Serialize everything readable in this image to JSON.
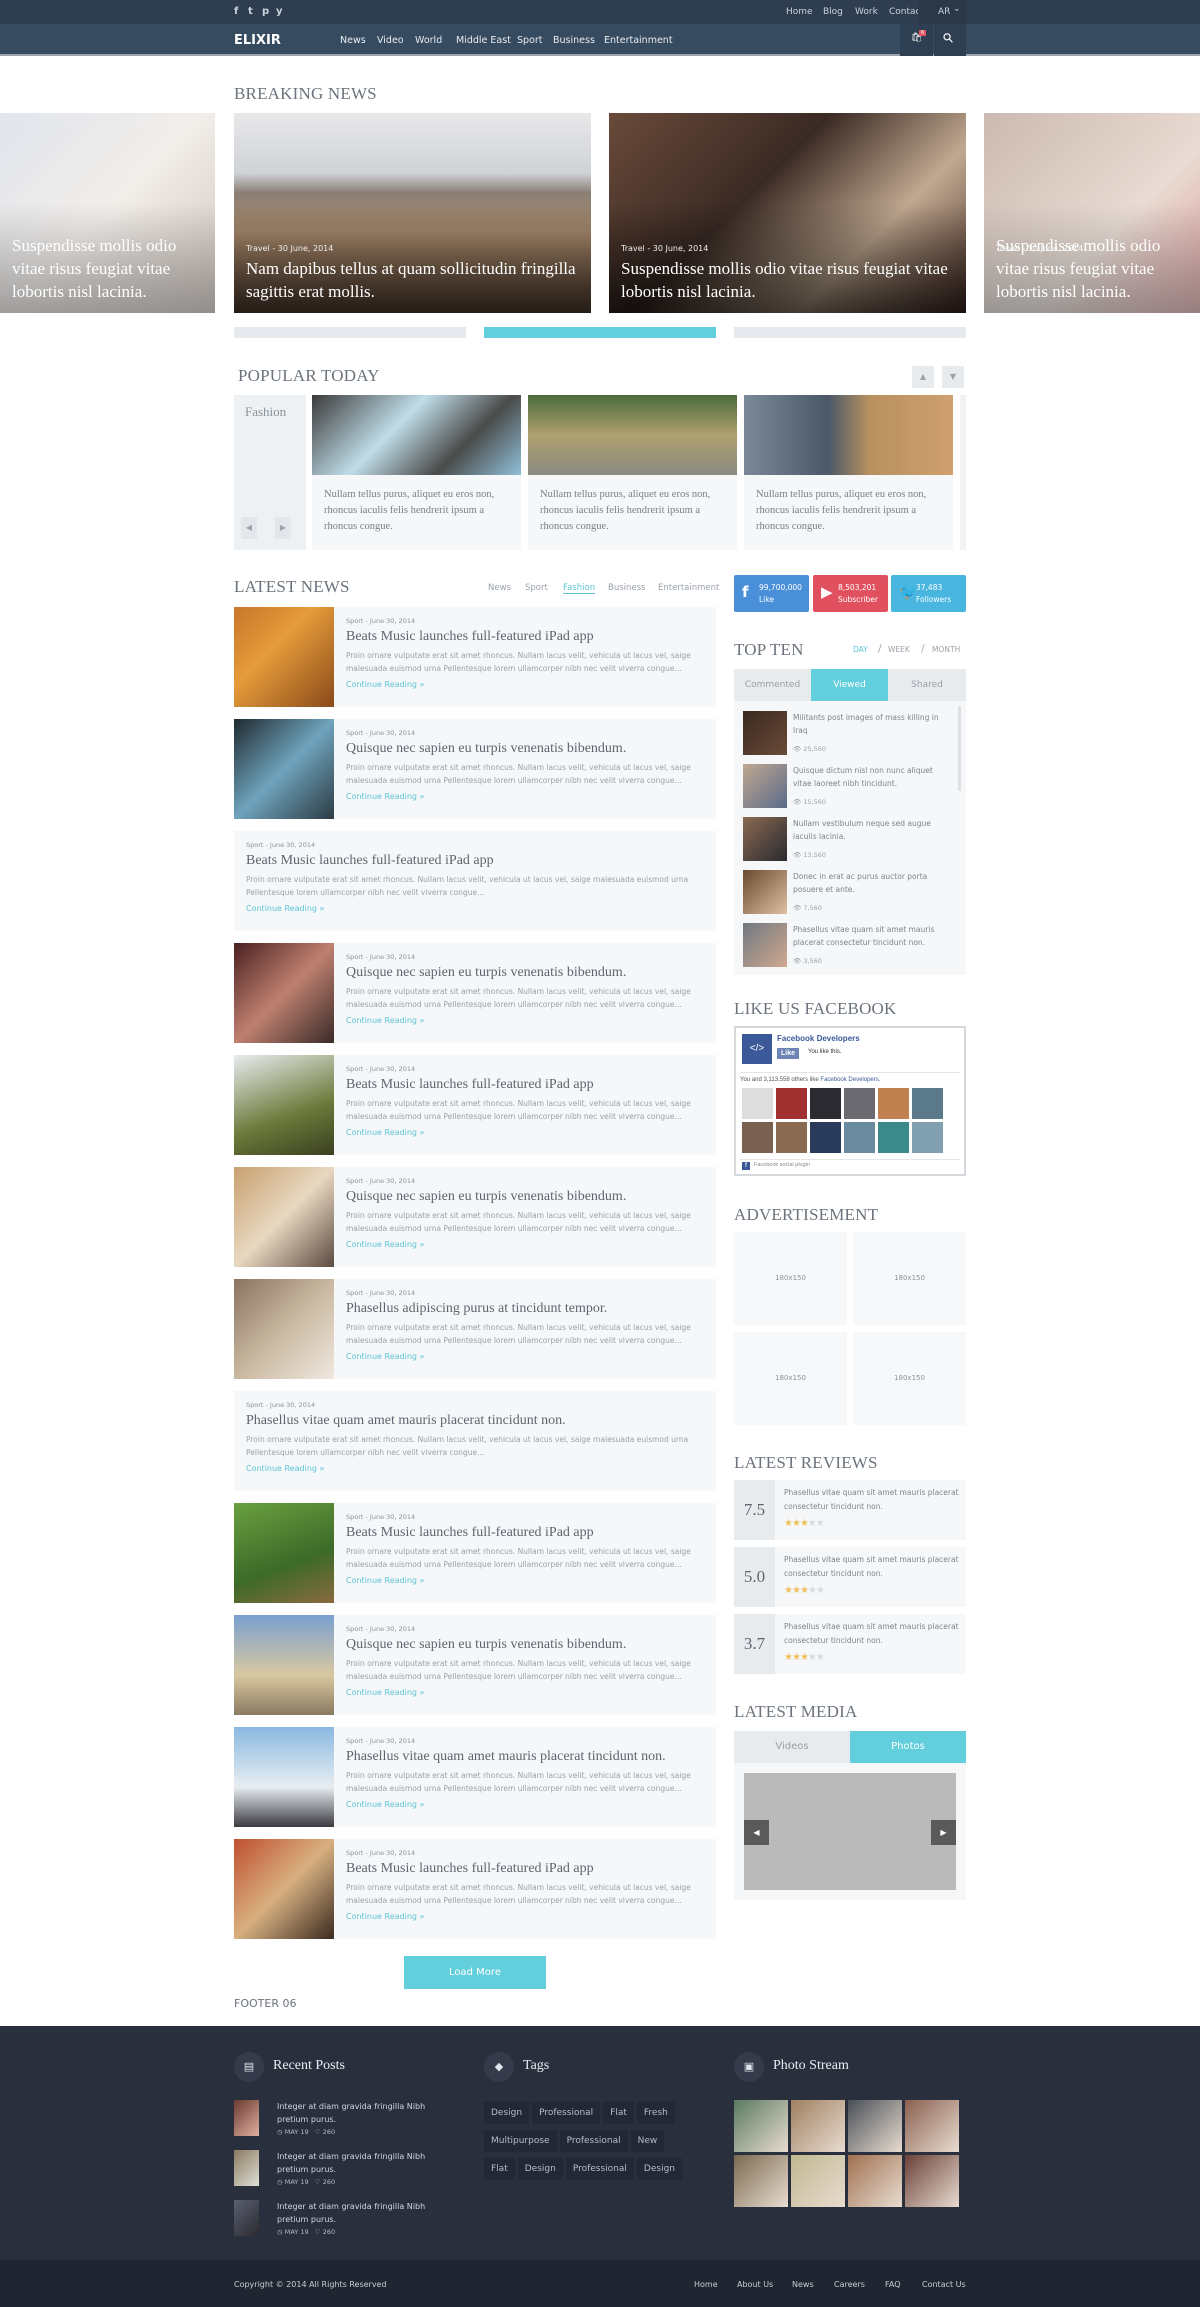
{
  "topbar": {
    "social_icons": [
      "facebook-icon",
      "twitter-icon",
      "pinterest-icon",
      "youtube-icon"
    ],
    "links": [
      "Home",
      "Blog",
      "Work",
      "Contact"
    ],
    "language": "AR"
  },
  "navbar": {
    "logo": "ELIXIR",
    "items": [
      "News",
      "Video",
      "World",
      "Middle East",
      "Sport",
      "Business",
      "Entertainment"
    ],
    "cart_count": "6"
  },
  "breaking": {
    "title": "BREAKING NEWS",
    "slides": [
      {
        "meta": "",
        "title": "Suspendisse mollis odio vitae risus feugiat vitae lobortis nisl lacinia."
      },
      {
        "meta": "Travel - 30 June, 2014",
        "title": "Nam dapibus tellus at quam sollicitudin fringilla sagittis erat mollis."
      },
      {
        "meta": "Travel - 30 June, 2014",
        "title": "Suspendisse mollis odio vitae risus feugiat vitae lobortis nisl lacinia."
      },
      {
        "meta": "Travel - 30 June, 2014",
        "title": "Suspendisse mollis odio vitae risus feugiat vitae lobortis nisl lacinia."
      }
    ],
    "active_page": 2
  },
  "popular": {
    "title": "POPULAR TODAY",
    "category": "Fashion",
    "cards": [
      {
        "text": "Nullam tellus purus, aliquet eu eros non, rhoncus iaculis felis hendrerit ipsum a rhoncus congue."
      },
      {
        "text": "Nullam tellus purus, aliquet eu eros non, rhoncus iaculis felis hendrerit ipsum a rhoncus congue."
      },
      {
        "text": "Nullam tellus purus, aliquet eu eros non, rhoncus iaculis felis hendrerit ipsum a rhoncus congue."
      }
    ]
  },
  "latest": {
    "title": "LATEST NEWS",
    "filters": [
      "News",
      "Sport",
      "Fashion",
      "Business",
      "Entertainment"
    ],
    "active_filter": "Fashion",
    "excerpt": "Proin ornare vulputate erat sit amet rhoncus. Nullam lacus velit, vehicula ut lacus vel, saige malesuada euismod urna Pellentesque  lorem ullamcorper nibh nec velit viverra congue...",
    "meta": "Sport - June 30, 2014",
    "more": "Continue Reading",
    "articles": [
      {
        "title": "Beats Music launches full-featured iPad app",
        "image": true
      },
      {
        "title": "Quisque nec sapien eu turpis venenatis bibendum.",
        "image": true
      },
      {
        "title": "Beats Music launches full-featured iPad app",
        "image": false
      },
      {
        "title": "Quisque nec sapien eu turpis venenatis bibendum.",
        "image": true
      },
      {
        "title": "Beats Music launches full-featured iPad app",
        "image": true
      },
      {
        "title": "Quisque nec sapien eu turpis venenatis bibendum.",
        "image": true
      },
      {
        "title": "Phasellus adipiscing purus at tincidunt tempor.",
        "image": true
      },
      {
        "title": "Phasellus vitae quam amet mauris placerat tincidunt non.",
        "image": false
      },
      {
        "title": "Beats Music launches full-featured iPad app",
        "image": true
      },
      {
        "title": "Quisque nec sapien eu turpis venenatis bibendum.",
        "image": true
      },
      {
        "title": "Phasellus vitae quam amet mauris placerat tincidunt non.",
        "image": true
      },
      {
        "title": "Beats Music launches full-featured iPad app",
        "image": true
      }
    ],
    "load_more": "Load More"
  },
  "footer_label": "FOOTER 06",
  "social": [
    {
      "icon": "facebook-icon",
      "count": "99,700,000",
      "label": "Like",
      "color": "#4a90d9"
    },
    {
      "icon": "youtube-icon",
      "count": "8,503,201",
      "label": "Subscriber",
      "color": "#e0505f"
    },
    {
      "icon": "twitter-icon",
      "count": "37,483",
      "label": "Followers",
      "color": "#49b6e0"
    }
  ],
  "topten": {
    "title": "TOP TEN",
    "periods": [
      "DAY",
      "WEEK",
      "MONTH"
    ],
    "active_period": "DAY",
    "tabs": [
      "Commented",
      "Viewed",
      "Shared"
    ],
    "active_tab": "Viewed",
    "items": [
      {
        "title": "Militants post images of mass killing in Iraq",
        "views": "25,560"
      },
      {
        "title": "Quisque dictum nisl non nunc aliquet vitae laoreet nibh tincidunt.",
        "views": "15,560"
      },
      {
        "title": "Nullam vestibulum neque sed augue iaculis lacinia.",
        "views": "13,560"
      },
      {
        "title": "Donec in erat ac purus auctor porta posuere et ante.",
        "views": "7,560"
      },
      {
        "title": "Phasellus vitae quam sit amet mauris placerat consectetur tincidunt non.",
        "views": "3,560"
      }
    ]
  },
  "facebook": {
    "title": "LIKE US FACEBOOK",
    "page_name": "Facebook Developers",
    "like_label": "Like",
    "you_like": "You like this.",
    "others_prefix": "You and 3,113,558 others like ",
    "others_link": "Facebook Developers.",
    "plugin_label": "Facebook social plugin"
  },
  "ads": {
    "title": "ADVERTISEMENT",
    "slots": [
      "180x150",
      "180x150",
      "180x150",
      "180x150"
    ]
  },
  "reviews": {
    "title": "LATEST REVIEWS",
    "items": [
      {
        "score": "7.5",
        "text": "Phasellus vitae quam sit amet mauris placerat consectetur tincidunt non.",
        "stars": 3
      },
      {
        "score": "5.0",
        "text": "Phasellus vitae quam sit amet mauris placerat consectetur tincidunt non.",
        "stars": 3
      },
      {
        "score": "3.7",
        "text": "Phasellus vitae quam sit amet mauris placerat consectetur tincidunt non.",
        "stars": 3
      }
    ],
    "max_stars": 5
  },
  "media": {
    "title": "LATEST MEDIA",
    "tabs": [
      "Videos",
      "Photos"
    ],
    "active_tab": "Photos"
  },
  "footer": {
    "recent_title": "Recent Posts",
    "posts": [
      {
        "title": "Integer at diam gravida fringilla Nibh pretium purus.",
        "date": "MAY 19",
        "likes": "260"
      },
      {
        "title": "Integer at diam gravida fringilla Nibh pretium purus.",
        "date": "MAY 19",
        "likes": "260"
      },
      {
        "title": "Integer at diam gravida fringilla Nibh pretium purus.",
        "date": "MAY 19",
        "likes": "260"
      }
    ],
    "tags_title": "Tags",
    "tags": [
      [
        "Design",
        "Professional",
        "Flat",
        "Fresh"
      ],
      [
        "Multipurpose",
        "Professional",
        "New"
      ],
      [
        "Flat",
        "Design",
        "Professional",
        "Design"
      ]
    ],
    "photos_title": "Photo Stream",
    "copyright": "Copyright © 2014 All Rights Reserved",
    "links": [
      "Home",
      "About Us",
      "News",
      "Careers",
      "FAQ",
      "Contact Us"
    ]
  },
  "colors": {
    "accent": "#63cfdc",
    "topbar": "#2e3d50",
    "navbar": "#364a60",
    "footer": "#2a2f3d",
    "star": "#f0c060"
  }
}
